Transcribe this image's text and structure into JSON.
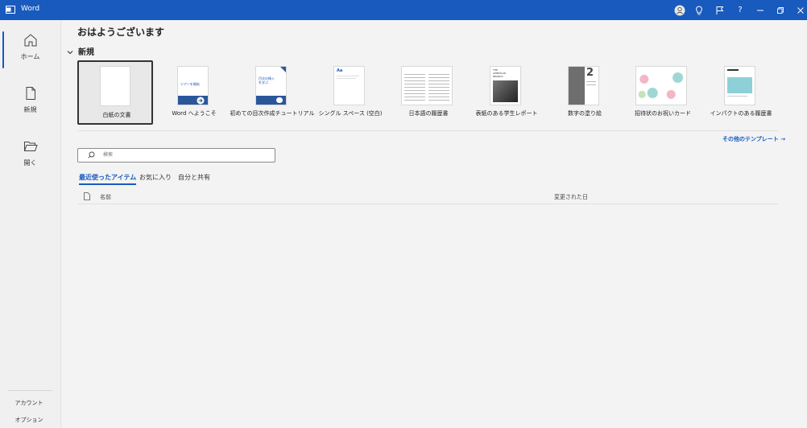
{
  "window": {
    "app_title": "Word"
  },
  "titlebar": {
    "buttons": [
      "account-icon",
      "lightbulb-icon",
      "feedback-icon",
      "help-icon",
      "minimize-icon",
      "restore-icon",
      "close-icon"
    ],
    "help_label": "?"
  },
  "sidebar": {
    "items": [
      {
        "label": "ホーム",
        "icon": "home-icon",
        "active": true
      },
      {
        "label": "新規",
        "icon": "new-document-icon",
        "active": false
      },
      {
        "label": "開く",
        "icon": "folder-open-icon",
        "active": false
      }
    ],
    "bottom": {
      "account": "アカウント",
      "options": "オプション"
    }
  },
  "main": {
    "greeting": "おはようございます",
    "new_section": {
      "title": "新規",
      "templates": [
        {
          "label": "白紙の文書",
          "selected": true
        },
        {
          "label": "Word へようこそ",
          "thumb_text": "ツアーを開始"
        },
        {
          "label": "初めての目次作成チュートリアル",
          "thumb_text": "目次の挿入を学ぶ"
        },
        {
          "label": "シングル スペース (空白)",
          "thumb_text": "Aa"
        },
        {
          "label": "日本語の履歴書"
        },
        {
          "label": "表紙のある学生レポート",
          "thumb_text": "THE AMERICAN BRANCH"
        },
        {
          "label": "数字の塗り絵",
          "thumb_text": "2"
        },
        {
          "label": "招待状のお祝いカード"
        },
        {
          "label": "インパクトのある履歴書"
        }
      ],
      "more_templates": "その他のテンプレート →"
    },
    "search": {
      "placeholder": "検索"
    },
    "tabs": [
      {
        "label": "最近使ったアイテム",
        "active": true
      },
      {
        "label": "お気に入り",
        "active": false
      },
      {
        "label": "自分と共有",
        "active": false
      }
    ],
    "list": {
      "col_name": "名前",
      "col_modified": "変更された日"
    }
  },
  "colors": {
    "accent": "#185abd",
    "titlebar": "#185abd",
    "background": "#f3f3f3"
  }
}
